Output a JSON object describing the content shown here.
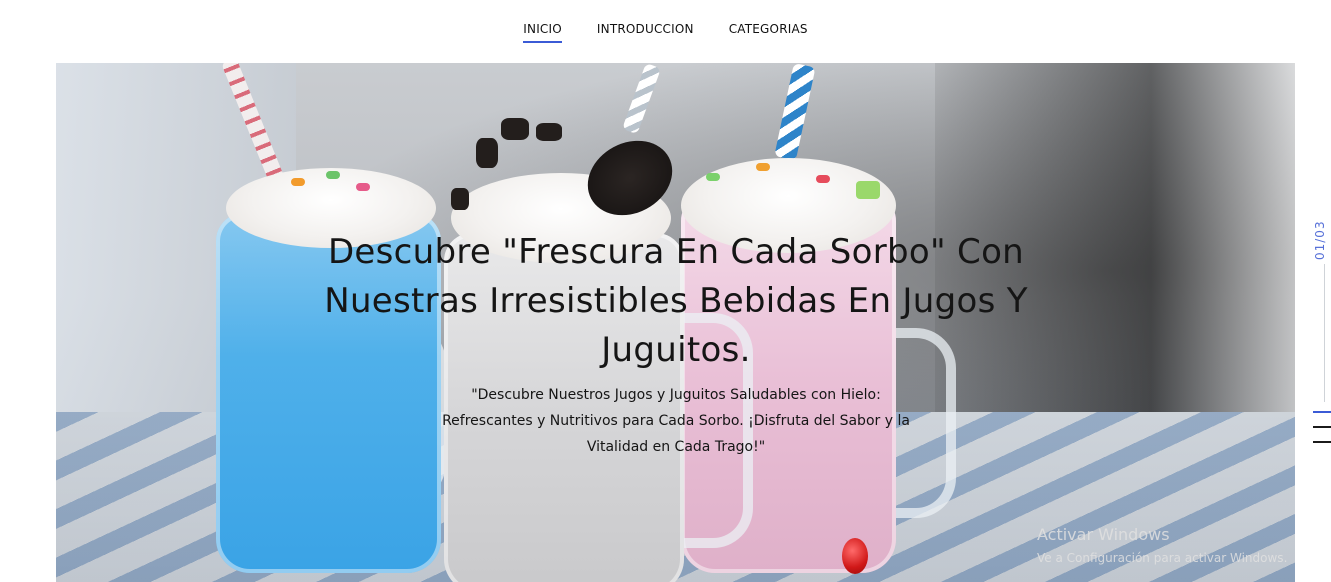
{
  "nav": {
    "items": [
      {
        "label": "INICIO",
        "active": true
      },
      {
        "label": "INTRODUCCION",
        "active": false
      },
      {
        "label": "CATEGORIAS",
        "active": false
      }
    ],
    "accent_color": "#3b5bd6"
  },
  "hero": {
    "title": "Descubre \"Frescura En Cada Sorbo\" Con Nuestras Irresistibles Bebidas En Jugos Y Juguitos.",
    "subtitle": "\"Descubre Nuestros Jugos y Juguitos Saludables con Hielo: Refrescantes y Nutritivos para Cada Sorbo. ¡Disfruta del Sabor y la Vitalidad en Cada Trago!\""
  },
  "slider": {
    "counter": "01/03",
    "current": 1,
    "total": 3
  },
  "watermark": {
    "line1": "Activar Windows",
    "line2": "Ve a Configuración para activar Windows."
  }
}
